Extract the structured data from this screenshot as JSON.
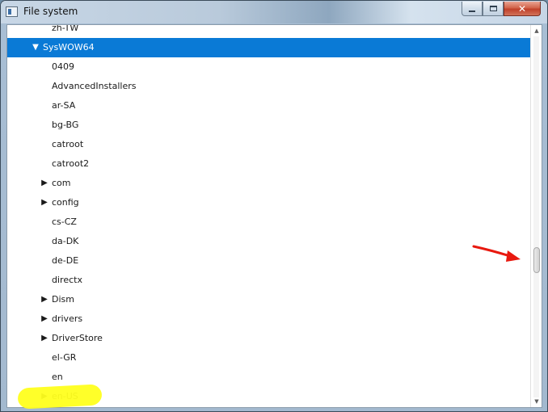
{
  "window": {
    "title": "File system",
    "close_glyph": "✕",
    "icons": {
      "app": "app-window-icon",
      "minimize": "minimize-icon",
      "maximize": "maximize-icon",
      "close": "close-icon"
    }
  },
  "tree": {
    "items": [
      {
        "label": "zh-TW",
        "has_children": false,
        "level": 2
      },
      {
        "label": "SysWOW64",
        "has_children": true,
        "expanded": true,
        "selected": true,
        "level": 1
      },
      {
        "label": "0409",
        "has_children": false,
        "level": 2
      },
      {
        "label": "AdvancedInstallers",
        "has_children": false,
        "level": 2
      },
      {
        "label": "ar-SA",
        "has_children": false,
        "level": 2
      },
      {
        "label": "bg-BG",
        "has_children": false,
        "level": 2
      },
      {
        "label": "catroot",
        "has_children": false,
        "level": 2
      },
      {
        "label": "catroot2",
        "has_children": false,
        "level": 2
      },
      {
        "label": "com",
        "has_children": true,
        "expanded": false,
        "level": 2
      },
      {
        "label": "config",
        "has_children": true,
        "expanded": false,
        "level": 2
      },
      {
        "label": "cs-CZ",
        "has_children": false,
        "level": 2
      },
      {
        "label": "da-DK",
        "has_children": false,
        "level": 2
      },
      {
        "label": "de-DE",
        "has_children": false,
        "level": 2
      },
      {
        "label": "directx",
        "has_children": false,
        "level": 2
      },
      {
        "label": "Dism",
        "has_children": true,
        "expanded": false,
        "level": 2
      },
      {
        "label": "drivers",
        "has_children": true,
        "expanded": false,
        "level": 2
      },
      {
        "label": "DriverStore",
        "has_children": true,
        "expanded": false,
        "level": 2
      },
      {
        "label": "el-GR",
        "has_children": false,
        "level": 2
      },
      {
        "label": "en",
        "has_children": false,
        "level": 2
      },
      {
        "label": "en-US",
        "has_children": true,
        "expanded": false,
        "highlighted": true,
        "level": 2
      }
    ]
  },
  "scrollbar": {
    "position_fraction": 0.63,
    "up_glyph": "▲",
    "down_glyph": "▼"
  },
  "annotations": {
    "arrow_color": "#e8190f",
    "highlight_color": "#ffff1e"
  },
  "colors": {
    "selection": "#0a7ad6"
  }
}
